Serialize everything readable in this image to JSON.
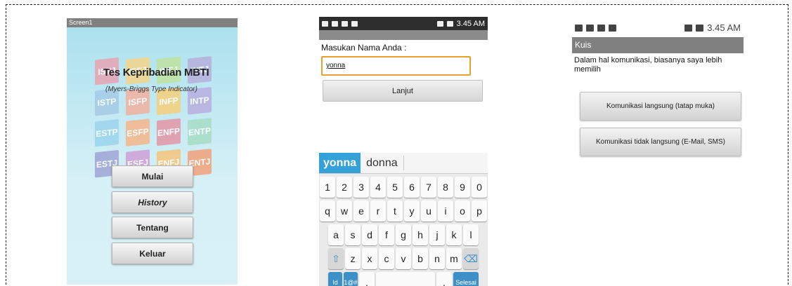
{
  "screen1": {
    "title": "Screen1",
    "app_title": "Tes Kepribadian MBTI",
    "app_subtitle": "(Myers-Briggs Type Indicator)",
    "tiles": [
      {
        "text": "ISTJ",
        "color": "#e8a4b4"
      },
      {
        "text": "ISFJ",
        "color": "#f4d58a"
      },
      {
        "text": "INFJ",
        "color": "#bfe3a0"
      },
      {
        "text": "INTJ",
        "color": "#b6b0dc"
      },
      {
        "text": "ISTP",
        "color": "#a5cbe6"
      },
      {
        "text": "ISFP",
        "color": "#f3b0a0"
      },
      {
        "text": "INFP",
        "color": "#f7d07a"
      },
      {
        "text": "INTP",
        "color": "#b8aee0"
      },
      {
        "text": "ESTP",
        "color": "#9bd5ec"
      },
      {
        "text": "ESFP",
        "color": "#f7b58a"
      },
      {
        "text": "ENFP",
        "color": "#e596a6"
      },
      {
        "text": "ENTP",
        "color": "#a7dcc6"
      },
      {
        "text": "ESTJ",
        "color": "#9fa5d6"
      },
      {
        "text": "ESFJ",
        "color": "#cfa0d6"
      },
      {
        "text": "ENFJ",
        "color": "#f7c47c"
      },
      {
        "text": "ENTJ",
        "color": "#f2a17a"
      }
    ],
    "buttons": {
      "mulai": "Mulai",
      "history": "History",
      "tentang": "Tentang",
      "keluar": "Keluar"
    }
  },
  "screen2": {
    "status_time": "3.45 AM",
    "label": "Masukan Nama Anda :",
    "input_value": "yonna",
    "button": "Lanjut",
    "suggestions": [
      "yonna",
      "donna"
    ],
    "keys_row1": [
      "1",
      "2",
      "3",
      "4",
      "5",
      "6",
      "7",
      "8",
      "9",
      "0"
    ],
    "keys_row2": [
      "q",
      "w",
      "e",
      "r",
      "t",
      "y",
      "u",
      "i",
      "o",
      "p"
    ],
    "keys_row3": [
      "a",
      "s",
      "d",
      "f",
      "g",
      "h",
      "j",
      "k",
      "l"
    ],
    "keys_row4": [
      "z",
      "x",
      "c",
      "v",
      "b",
      "n",
      "m"
    ],
    "key_shift": "⇧",
    "key_backspace": "⌫",
    "key_lang": "Id",
    "key_sym": "1@#",
    "key_comma": ",",
    "key_space": "⎵",
    "key_period": ".",
    "key_done": "Selesai"
  },
  "screen3": {
    "status_time": "3.45 AM",
    "title": "Kuis",
    "question": "Dalam hal komunikasi, biasanya saya lebih memilih",
    "option1": "Komunikasi langsung (tatap muka)",
    "option2": "Komunikasi tidak langsung (E-Mail, SMS)"
  }
}
